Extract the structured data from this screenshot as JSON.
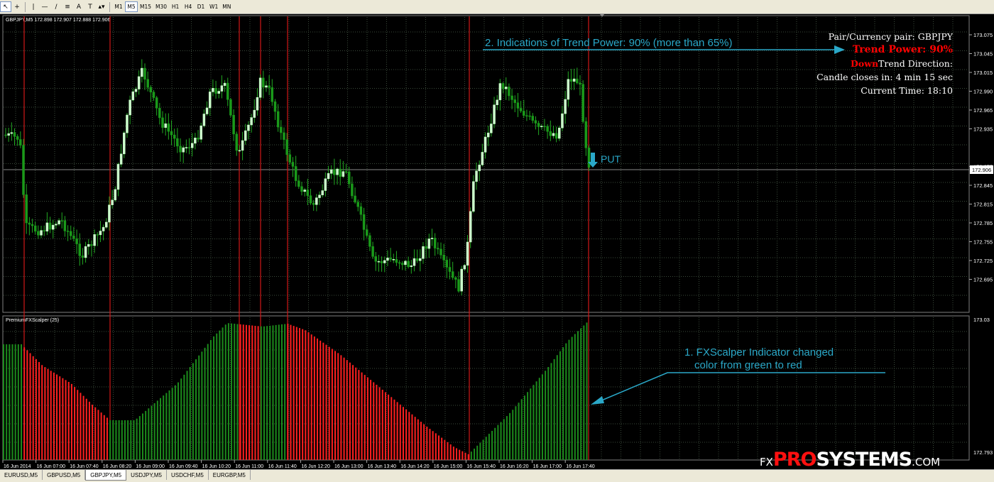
{
  "toolbar": {
    "icons": [
      "cursor-icon",
      "crosshair-icon",
      "vertical-line-icon",
      "horizontal-line-icon",
      "trendline-icon",
      "channel-icon",
      "text-icon",
      "label-icon",
      "shapes-icon"
    ],
    "text_tool": "A",
    "label_tool": "T",
    "timeframes": [
      "M1",
      "M5",
      "M15",
      "M30",
      "H1",
      "H4",
      "D1",
      "W1",
      "MN"
    ],
    "active_timeframe": "M5"
  },
  "chart": {
    "header": "GBPJPY,M5  172.898 172.907 172.888 172.906",
    "current_price": "172.906",
    "price_ticks": [
      "173.075",
      "173.045",
      "173.015",
      "172.990",
      "172.965",
      "172.935",
      "172.906",
      "172.875",
      "172.845",
      "172.815",
      "172.785",
      "172.755",
      "172.725",
      "172.695"
    ],
    "time_ticks": [
      "16 Jun 2014",
      "16 Jun 07:00",
      "16 Jun 07:40",
      "16 Jun 08:20",
      "16 Jun 09:00",
      "16 Jun 09:40",
      "16 Jun 10:20",
      "16 Jun 11:00",
      "16 Jun 11:40",
      "16 Jun 12:20",
      "16 Jun 13:00",
      "16 Jun 13:40",
      "16 Jun 14:20",
      "16 Jun 15:00",
      "16 Jun 15:40",
      "16 Jun 16:20",
      "16 Jun 17:00",
      "16 Jun 17:40"
    ],
    "signal_label": "PUT",
    "annotation_top": "2. Indications of Trend Power: 90% (more than 65%)",
    "annotation_bottom_line1": "1. FXScalper Indicator changed",
    "annotation_bottom_line2": "color from green to red"
  },
  "info": {
    "pair": "Pair/Currency pair: GBPJPY",
    "trend_power": "Trend Power: 90%",
    "direction_value": "Down",
    "direction_label": "Trend Direction:",
    "candle_closes": "Candle closes in: 4 min 15 sec",
    "current_time": "Current Time: 18:10"
  },
  "indicator": {
    "label": "PremiumFXScalper (25)",
    "top_tick": "173.03",
    "bottom_tick": "172.793",
    "colors": {
      "up": "#1c8c1c",
      "down": "#ff2020"
    }
  },
  "logo": {
    "fx": "FX",
    "pro": "PRO",
    "systems": "SYSTEMS",
    "com": ".COM"
  },
  "tabs": [
    "EURUSD,M5",
    "GBPUSD,M5",
    "GBPJPY,M5",
    "USDJPY,M5",
    "USDCHF,M5",
    "EURGBP,M5"
  ],
  "active_tab": "GBPJPY,M5",
  "colors": {
    "bull": "#ccffcc",
    "bear": "#1a9a1a",
    "wick": "#22aa22",
    "grid": "#3a4a3a",
    "annotation": "#2aa8c8",
    "signal_line": "#d01818"
  }
}
